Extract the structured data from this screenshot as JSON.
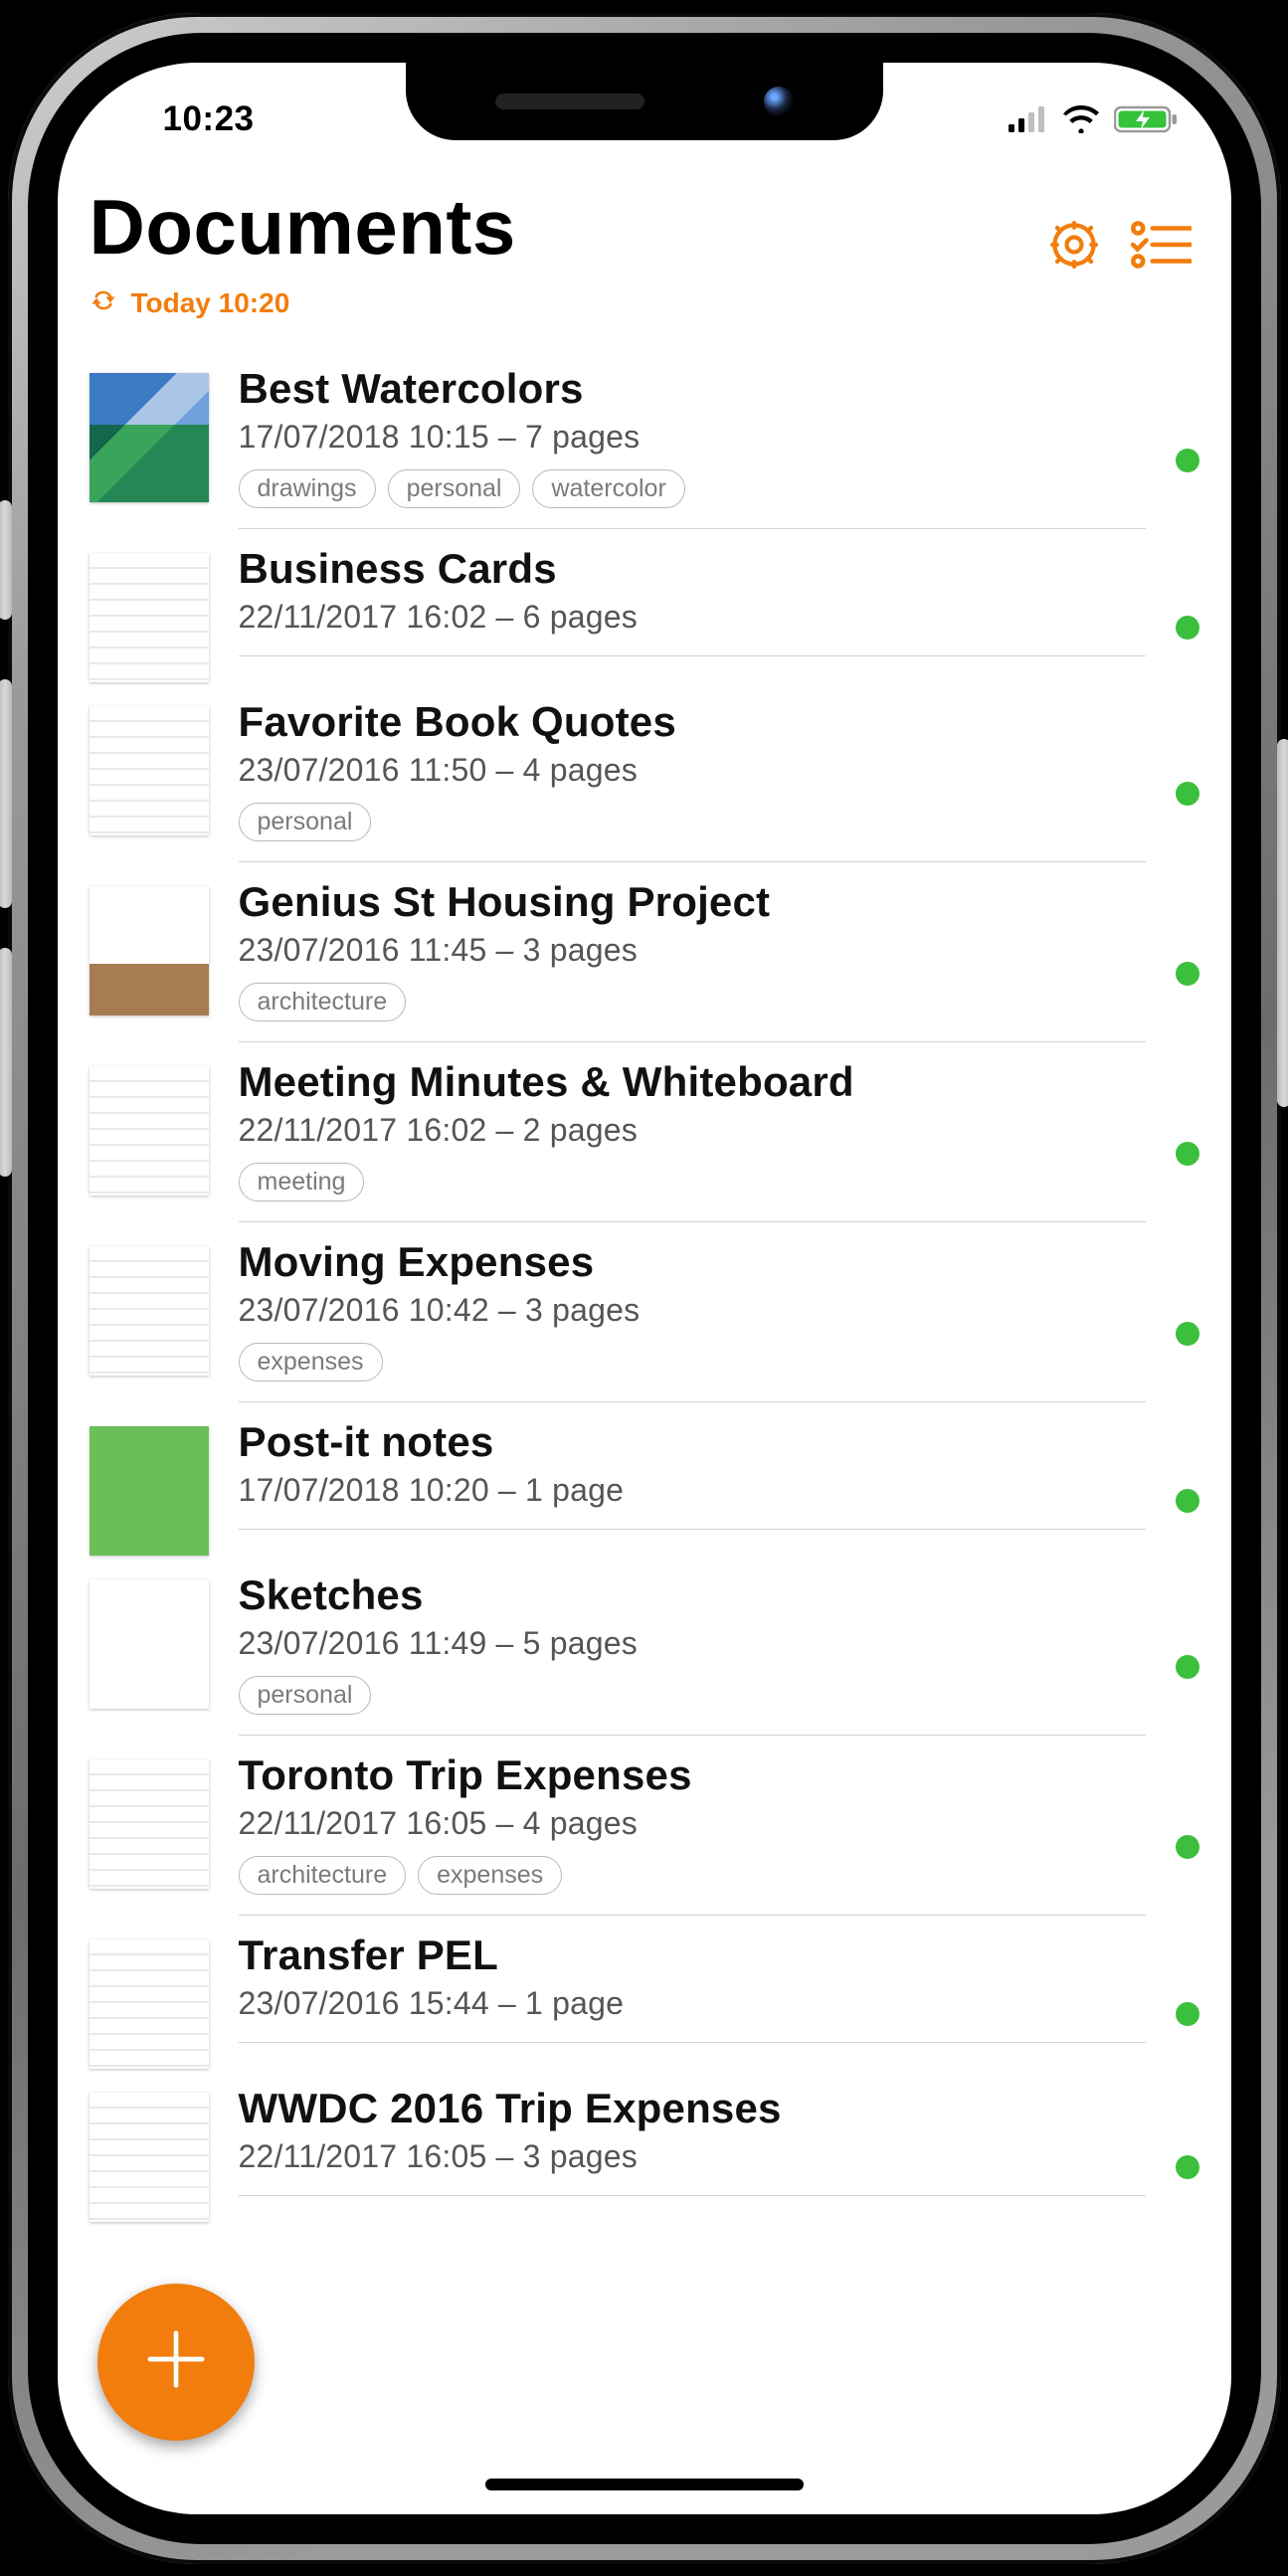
{
  "status_bar": {
    "time": "10:23"
  },
  "header": {
    "title": "Documents",
    "sync_label": "Today 10:20"
  },
  "documents": [
    {
      "title": "Best Watercolors",
      "meta": "17/07/2018 10:15 – 7 pages",
      "tags": [
        "drawings",
        "personal",
        "watercolor"
      ],
      "thumb": "water",
      "synced": true
    },
    {
      "title": "Business Cards",
      "meta": "22/11/2017 16:02 – 6 pages",
      "tags": [],
      "thumb": "paper",
      "synced": true
    },
    {
      "title": "Favorite Book Quotes",
      "meta": "23/07/2016 11:50 – 4 pages",
      "tags": [
        "personal"
      ],
      "thumb": "paper",
      "synced": true
    },
    {
      "title": "Genius St Housing Project",
      "meta": "23/07/2016 11:45 – 3 pages",
      "tags": [
        "architecture"
      ],
      "thumb": "photo",
      "synced": true
    },
    {
      "title": "Meeting Minutes & Whiteboard",
      "meta": "22/11/2017 16:02 – 2 pages",
      "tags": [
        "meeting"
      ],
      "thumb": "paper",
      "synced": true
    },
    {
      "title": "Moving Expenses",
      "meta": "23/07/2016 10:42 – 3 pages",
      "tags": [
        "expenses"
      ],
      "thumb": "paper",
      "synced": true
    },
    {
      "title": "Post-it notes",
      "meta": "17/07/2018 10:20 – 1 page",
      "tags": [],
      "thumb": "green",
      "synced": true
    },
    {
      "title": "Sketches",
      "meta": "23/07/2016 11:49 – 5 pages",
      "tags": [
        "personal"
      ],
      "thumb": "sketch",
      "synced": true
    },
    {
      "title": "Toronto Trip Expenses",
      "meta": "22/11/2017 16:05 – 4 pages",
      "tags": [
        "architecture",
        "expenses"
      ],
      "thumb": "paper",
      "synced": true
    },
    {
      "title": "Transfer PEL",
      "meta": "23/07/2016 15:44 – 1 page",
      "tags": [],
      "thumb": "paper",
      "synced": true
    },
    {
      "title": "WWDC 2016 Trip Expenses",
      "meta": "22/11/2017 16:05 – 3 pages",
      "tags": [],
      "thumb": "paper",
      "synced": true
    }
  ]
}
